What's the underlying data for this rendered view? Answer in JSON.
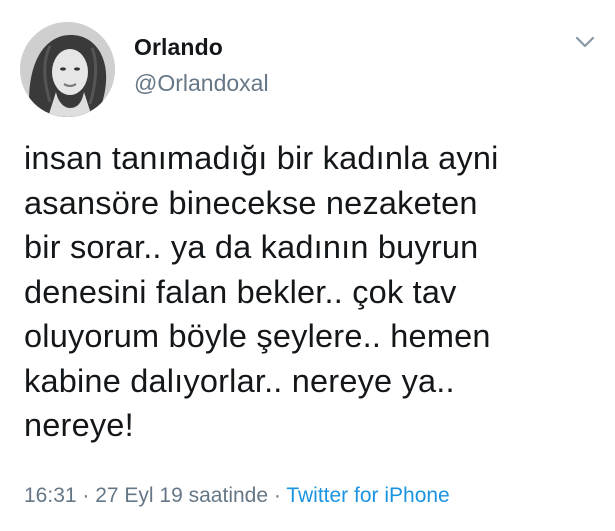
{
  "user": {
    "display_name": "Orlando",
    "handle": "@Orlandoxal",
    "avatar_icon": "profile-photo"
  },
  "tweet": {
    "text": "insan tanımadığı bir kadınla ayni\nasansöre binecekse nezaketen\nbir sorar.. ya da kadının buyrun\ndenesini falan bekler.. çok tav\noluyorum böyle şeylere.. hemen\nkabine dalıyorlar.. nereye ya..\nnereye!"
  },
  "meta": {
    "time": "16:31",
    "sep1": " · ",
    "date": "27 Eyl 19 saatinde",
    "sep2": " · ",
    "source": "Twitter for iPhone"
  },
  "icons": {
    "menu": "chevron-down-icon"
  },
  "colors": {
    "text": "#14171a",
    "secondary": "#657786",
    "link": "#1b95e0"
  }
}
